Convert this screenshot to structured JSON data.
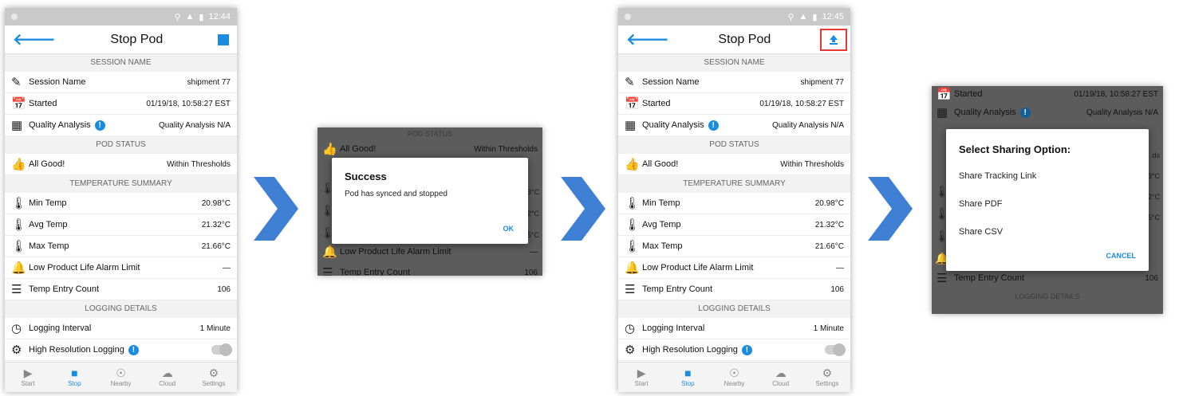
{
  "colors": {
    "accent": "#1a8de0",
    "highlight": "#e53935",
    "arrow": "#3f7fd4"
  },
  "screen1": {
    "status_time": "12:44",
    "title": "Stop Pod",
    "session_header": "SESSION NAME",
    "session_rows": [
      {
        "icon": "pencil-icon",
        "label": "Session Name",
        "value": "shipment 77"
      },
      {
        "icon": "calendar-icon",
        "label": "Started",
        "value": "01/19/18, 10:58:27 EST"
      },
      {
        "icon": "calculator-icon",
        "label": "Quality Analysis",
        "value": "Quality Analysis N/A"
      }
    ],
    "pod_header": "POD STATUS",
    "pod_row": {
      "icon": "thumbs-up-icon",
      "label": "All Good!",
      "value": "Within Thresholds"
    },
    "temp_header": "TEMPERATURE SUMMARY",
    "temp_rows": [
      {
        "icon": "thermometer-icon",
        "label": "Min Temp",
        "value": "20.98°C"
      },
      {
        "icon": "thermometer-icon",
        "label": "Avg Temp",
        "value": "21.32°C"
      },
      {
        "icon": "thermometer-icon",
        "label": "Max Temp",
        "value": "21.66°C"
      },
      {
        "icon": "bell-icon",
        "label": "Low Product Life Alarm Limit",
        "value": "—"
      },
      {
        "icon": "list-icon",
        "label": "Temp Entry Count",
        "value": "106"
      }
    ],
    "logging_header": "LOGGING DETAILS",
    "logging_rows": [
      {
        "icon": "clock-icon",
        "label": "Logging Interval",
        "value": "1 Minute"
      },
      {
        "icon": "gears-icon",
        "label": "High Resolution Logging",
        "value": ""
      }
    ],
    "nav": [
      "Start",
      "Stop",
      "Nearby",
      "Cloud",
      "Settings"
    ]
  },
  "screen2": {
    "pod_header": "POD STATUS",
    "pod_row": {
      "label": "All Good!",
      "value": "Within Thresholds"
    },
    "partial_values": [
      "3°C",
      "2°C",
      "5°C"
    ],
    "alarm_label": "Low Product Life Alarm Limit",
    "alarm_value": "—",
    "count_label": "Temp Entry Count",
    "count_value": "106",
    "dialog": {
      "title": "Success",
      "message": "Pod has synced and stopped",
      "ok": "OK"
    }
  },
  "screen3": {
    "status_time": "12:45",
    "title": "Stop Pod"
  },
  "screen4": {
    "started_label": "Started",
    "started_value": "01/19/18, 10:58:27 EST",
    "qa_label": "Quality Analysis",
    "qa_value": "Quality Analysis N/A",
    "partial_values": [
      "ds",
      "3°C",
      "2°C",
      "5°C"
    ],
    "count_label": "Temp Entry Count",
    "count_value": "106",
    "logging_header": "LOGGING DETAILS",
    "dialog": {
      "title": "Select Sharing Option:",
      "options": [
        "Share Tracking Link",
        "Share PDF",
        "Share CSV"
      ],
      "cancel": "CANCEL"
    }
  }
}
